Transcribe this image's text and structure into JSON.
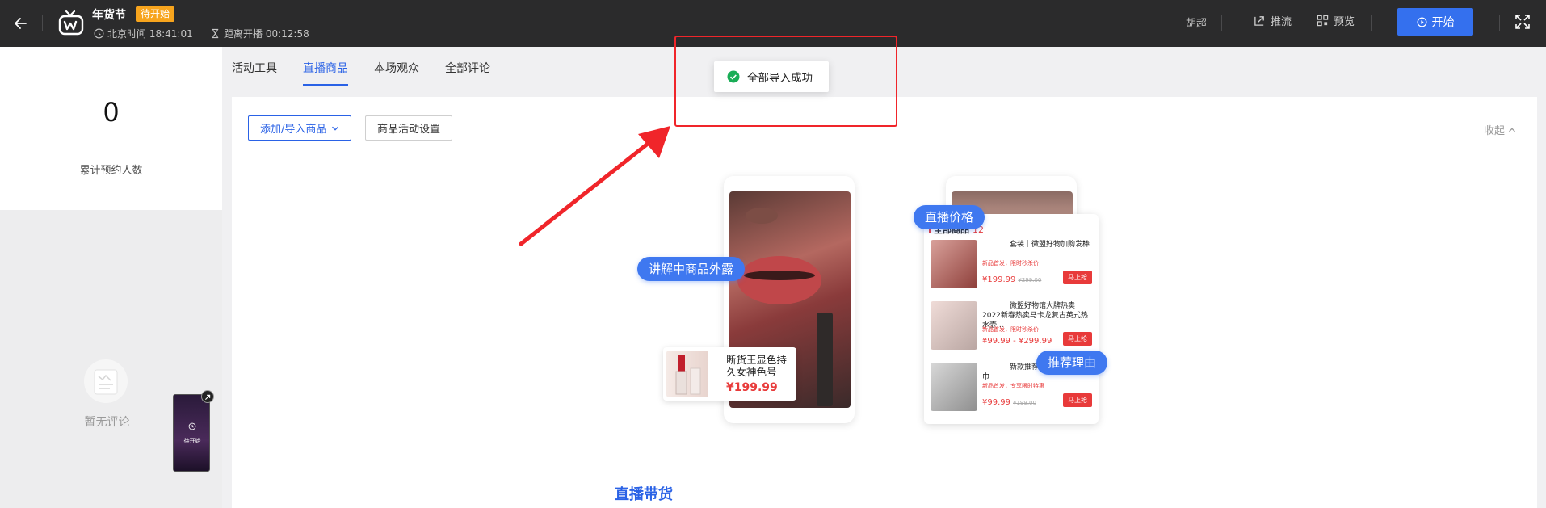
{
  "header": {
    "title": "年货节",
    "status_badge": "待开始",
    "beijing_time": "北京时间 18:41:01",
    "countdown": "距离开播 00:12:58",
    "user_name": "胡超",
    "push_stream": "推流",
    "preview": "预览",
    "start": "开始"
  },
  "left_panel": {
    "reservation_count": "0",
    "reservation_label": "累计预约人数",
    "no_comment": "暂无评论",
    "mini_preview_label": "待开始"
  },
  "tabs": [
    {
      "label": "活动工具",
      "active": false
    },
    {
      "label": "直播商品",
      "active": true
    },
    {
      "label": "本场观众",
      "active": false
    },
    {
      "label": "全部评论",
      "active": false
    }
  ],
  "toolbar": {
    "add_import": "添加/导入商品",
    "activity_settings": "商品活动设置",
    "collapse": "收起"
  },
  "toast": {
    "message": "全部导入成功"
  },
  "illustration": {
    "bubble_explain": "讲解中商品外露",
    "bubble_price": "直播价格",
    "bubble_reason": "推荐理由",
    "featured_product_name": "断货王显色持久女神色号",
    "featured_product_price": "¥199.99",
    "panel_title": "全部商品",
    "panel_count": "12",
    "panel_items": [
      {
        "title": "套装｜微盟好物加购发棒",
        "sub": "新品首发，限时秒杀价",
        "price": "¥199.99",
        "old": "¥299.00",
        "button": "马上抢"
      },
      {
        "title": "微盟好物馆大牌热卖2022新春热卖马卡龙复古英式热水壶...",
        "sub": "新品首发，限时秒杀价",
        "price": "¥99.99 - ¥299.99",
        "old": "",
        "button": "马上抢"
      },
      {
        "title": "新款推荐新款推荐全棉浴巾",
        "sub": "新品首发，专享限时特惠",
        "price": "¥99.99",
        "old": "¥199.00",
        "button": "马上抢"
      }
    ],
    "section_title": "直播带货"
  },
  "colors": {
    "accent": "#2a62e6",
    "badge": "#f7a41d",
    "annotation": "#f0252a",
    "success": "#1aad56"
  }
}
